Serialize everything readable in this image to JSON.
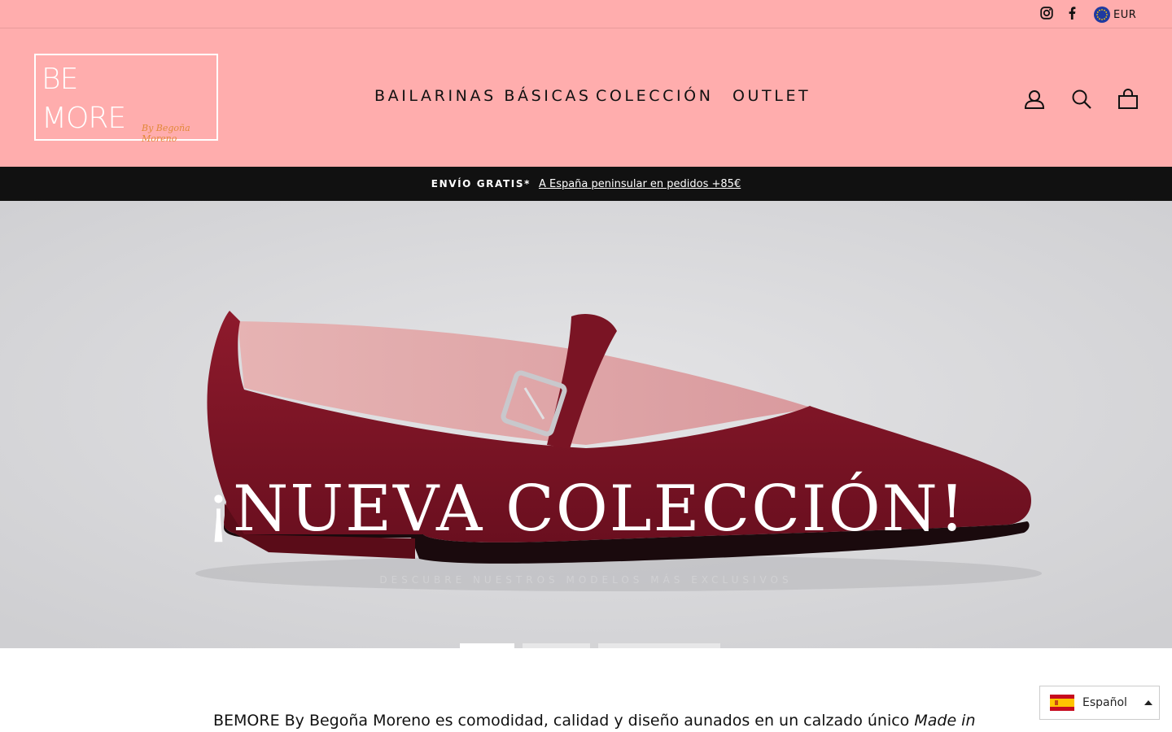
{
  "utility_bar": {
    "instagram_icon": "instagram-icon",
    "facebook_icon": "facebook-icon",
    "currency": "EUR"
  },
  "header": {
    "logo": {
      "line1": "BE",
      "line2": "MORE",
      "byline": "By Begoña Moreno"
    },
    "nav": [
      "BAILARINAS BÁSICAS",
      "COLECCIÓN",
      "OUTLET"
    ],
    "icons": [
      "user-icon",
      "search-icon",
      "cart-icon"
    ]
  },
  "announcement": {
    "strong": "ENVÍO GRATIS*",
    "link": "A España peninsular en pedidos +85€"
  },
  "hero": {
    "title": "¡NUEVA COLECCIÓN!",
    "subtitle": "DESCUBRE NUESTROS MODELOS MÁS EXCLUSIVOS",
    "slides": 3,
    "active_slide": 1
  },
  "intro": {
    "text": "BEMORE By Begoña Moreno es comodidad, calidad y diseño aunados en un calzado único ",
    "emphasis": "Made in"
  },
  "language": {
    "label": "Español"
  },
  "colors": {
    "header_bg": "#ffadad",
    "announce_bg": "#111111",
    "shoe": "#7d1525"
  }
}
